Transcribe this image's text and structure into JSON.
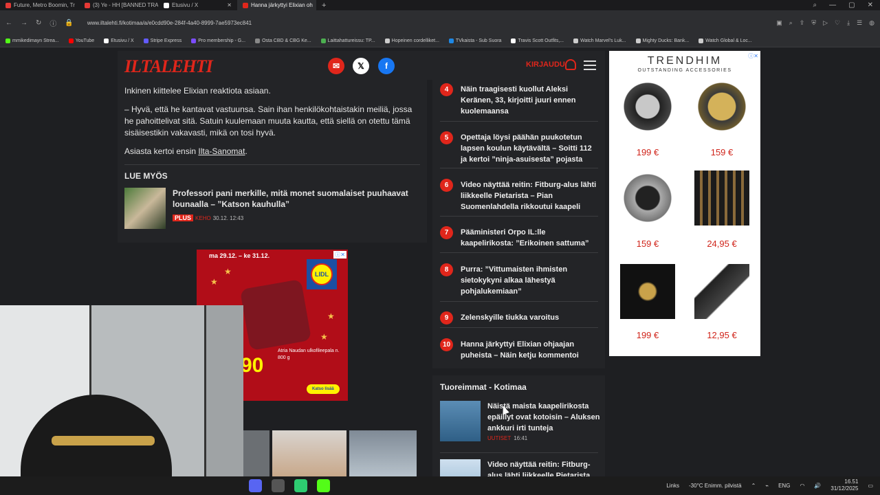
{
  "browser": {
    "tabs": [
      {
        "label": "Future, Metro Boomin, Tr",
        "color": "#e53935"
      },
      {
        "label": "(3) Ye - HH [BANNED TRA",
        "color": "#e53935"
      },
      {
        "label": "Etusivu / X",
        "color": "#ffffff"
      },
      {
        "label": "Hanna järkyttyi Elixian oh",
        "color": "#e0261b"
      }
    ],
    "new_tab": "+",
    "url": "www.iltalehti.fi/kotimaa/a/e0cdd90e-284f-4a40-8999-7ae5973ec841",
    "bookmarks": [
      {
        "label": "mmikedimayn Strea...",
        "color": "#53fc18"
      },
      {
        "label": "YouTube",
        "color": "#ff0000"
      },
      {
        "label": "Etusivu / X",
        "color": "#ffffff"
      },
      {
        "label": "Stripe Express",
        "color": "#635bff"
      },
      {
        "label": "Pro membership - G...",
        "color": "#7c4dff"
      },
      {
        "label": "Osta CBD & CBG Ke...",
        "color": "#888888"
      },
      {
        "label": "Laittahattureissu: TP...",
        "color": "#4caf50"
      },
      {
        "label": "Hopeinen cordelliket...",
        "color": "#cccccc"
      },
      {
        "label": "TVkaista - Sub Suora",
        "color": "#1e88e5"
      },
      {
        "label": "Travis Scott Outfits,...",
        "color": "#ffffff"
      },
      {
        "label": "Watch Marvel's Luk...",
        "color": "#cccccc"
      },
      {
        "label": "Mighty Ducks: Bank...",
        "color": "#cccccc"
      },
      {
        "label": "Watch Global & Loc...",
        "color": "#cccccc"
      }
    ]
  },
  "site": {
    "logo": "ILTALEHTI",
    "login": "KIRJAUDU",
    "accent": "#e0261b"
  },
  "article": {
    "p1": "Inkinen kiittelee Elixian reaktiota asiaan.",
    "p2": "– Hyvä, että he kantavat vastuunsa. Sain ihan henkilökohtaistakin meiliä, jossa he pahoittelivat sitä. Satuin kuulemaan muuta kautta, että siellä on otettu tämä sisäisestikin vakavasti, mikä on tosi hyvä.",
    "p3_prefix": "Asiasta kertoi ensin ",
    "p3_link": "Ilta-Sanomat",
    "p3_suffix": ".",
    "related_heading": "LUE MYÖS",
    "related_title": "Professori pani merkille, mitä monet suomalaiset puuhaavat lounaalla – ”Katson kauhulla”",
    "related_plus": "PLUS",
    "related_section": "KEHO",
    "related_time": "30.12. 12:43"
  },
  "lidl_ad": {
    "date": "ma 29.12. – ke 31.12.",
    "logo": "LIDL",
    "price": "90",
    "product": "Atria Naudan ulkofileepala n. 800 g",
    "cta": "Katso lisää"
  },
  "most_read": [
    {
      "num": "4",
      "title": "Näin traagisesti kuollut Aleksi Keränen, 33, kirjoitti juuri ennen kuolemaansa"
    },
    {
      "num": "5",
      "title": "Opettaja löysi päähän puukotetun lapsen koulun käytävältä – Soitti 112 ja kertoi ”ninja-asuisesta” pojasta"
    },
    {
      "num": "6",
      "title": "Video näyttää reitin: Fitburg-alus lähti liikkeelle Pietarista – Pian Suomenlahdella rikkoutui kaapeli"
    },
    {
      "num": "7",
      "title": "Pääministeri Orpo IL:lle kaapelirikosta: ”Erikoinen sattuma”"
    },
    {
      "num": "8",
      "title": "Purra: ”Vittumaisten ihmisten sietokykyni alkaa lähestyä pohjalukemiaan”"
    },
    {
      "num": "9",
      "title": "Zelenskyille tiukka varoitus"
    },
    {
      "num": "10",
      "title": "Hanna järkyttyi Elixian ohjaajan puheista – Näin ketju kommentoi"
    }
  ],
  "fresh": {
    "heading": "Tuoreimmat - Kotimaa",
    "items": [
      {
        "title": "Näistä maista kaapelirikosta epäillyt ovat kotoisin – Aluksen ankkuri irti tunteja",
        "tag": "UUTISET",
        "time": "16:41"
      },
      {
        "title": "Video näyttää reitin: Fitburg-alus lähti liikkeelle Pietarista",
        "tag": "",
        "time": ""
      }
    ]
  },
  "trendhim": {
    "logo": "TRENDHIM",
    "tagline": "OUTSTANDING ACCESSORIES",
    "prices": [
      "199 €",
      "159 €",
      "159 €",
      "24,95 €",
      "199 €",
      "12,95 €"
    ]
  },
  "taskbar": {
    "links": "Links",
    "weather": "-30°C Enimm. pilvistä",
    "lang": "ENG",
    "time": "16.51",
    "date": "31/12/2025"
  }
}
